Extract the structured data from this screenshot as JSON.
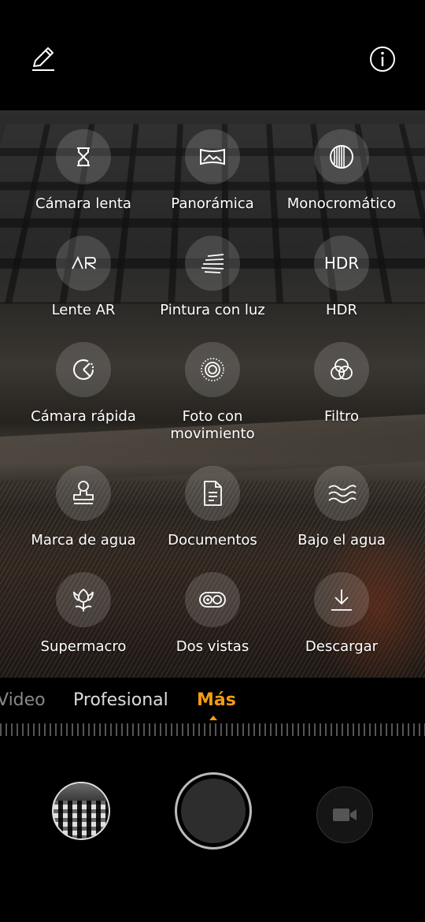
{
  "top_bar": {
    "edit_icon": "pencil-icon",
    "info_icon": "info-icon"
  },
  "modes": [
    {
      "label": "Cámara lenta",
      "icon": "hourglass-icon"
    },
    {
      "label": "Panorámica",
      "icon": "panorama-icon"
    },
    {
      "label": "Monocromático",
      "icon": "monochrome-icon"
    },
    {
      "label": "Lente AR",
      "icon": "ar-lens-icon"
    },
    {
      "label": "Pintura con luz",
      "icon": "light-painting-icon"
    },
    {
      "label": "HDR",
      "icon": "hdr-icon"
    },
    {
      "label": "Cámara rápida",
      "icon": "time-lapse-icon"
    },
    {
      "label": "Foto con\nmovimiento",
      "icon": "moving-picture-icon"
    },
    {
      "label": "Filtro",
      "icon": "filter-icon"
    },
    {
      "label": "Marca de agua",
      "icon": "watermark-stamp-icon"
    },
    {
      "label": "Documentos",
      "icon": "document-icon"
    },
    {
      "label": "Bajo el agua",
      "icon": "underwater-waves-icon"
    },
    {
      "label": "Supermacro",
      "icon": "flower-macro-icon"
    },
    {
      "label": "Dos vistas",
      "icon": "dual-view-icon"
    },
    {
      "label": "Descargar",
      "icon": "download-icon"
    }
  ],
  "hdr_text": "HDR",
  "ar_text": "AR",
  "mode_tabs": {
    "video": "Video",
    "pro": "Profesional",
    "more": "Más",
    "active": "Más",
    "active_color": "#f39c12"
  },
  "controls": {
    "gallery_icon": "gallery-thumbnail",
    "shutter_icon": "shutter-button",
    "video_icon": "video-camera-icon"
  }
}
